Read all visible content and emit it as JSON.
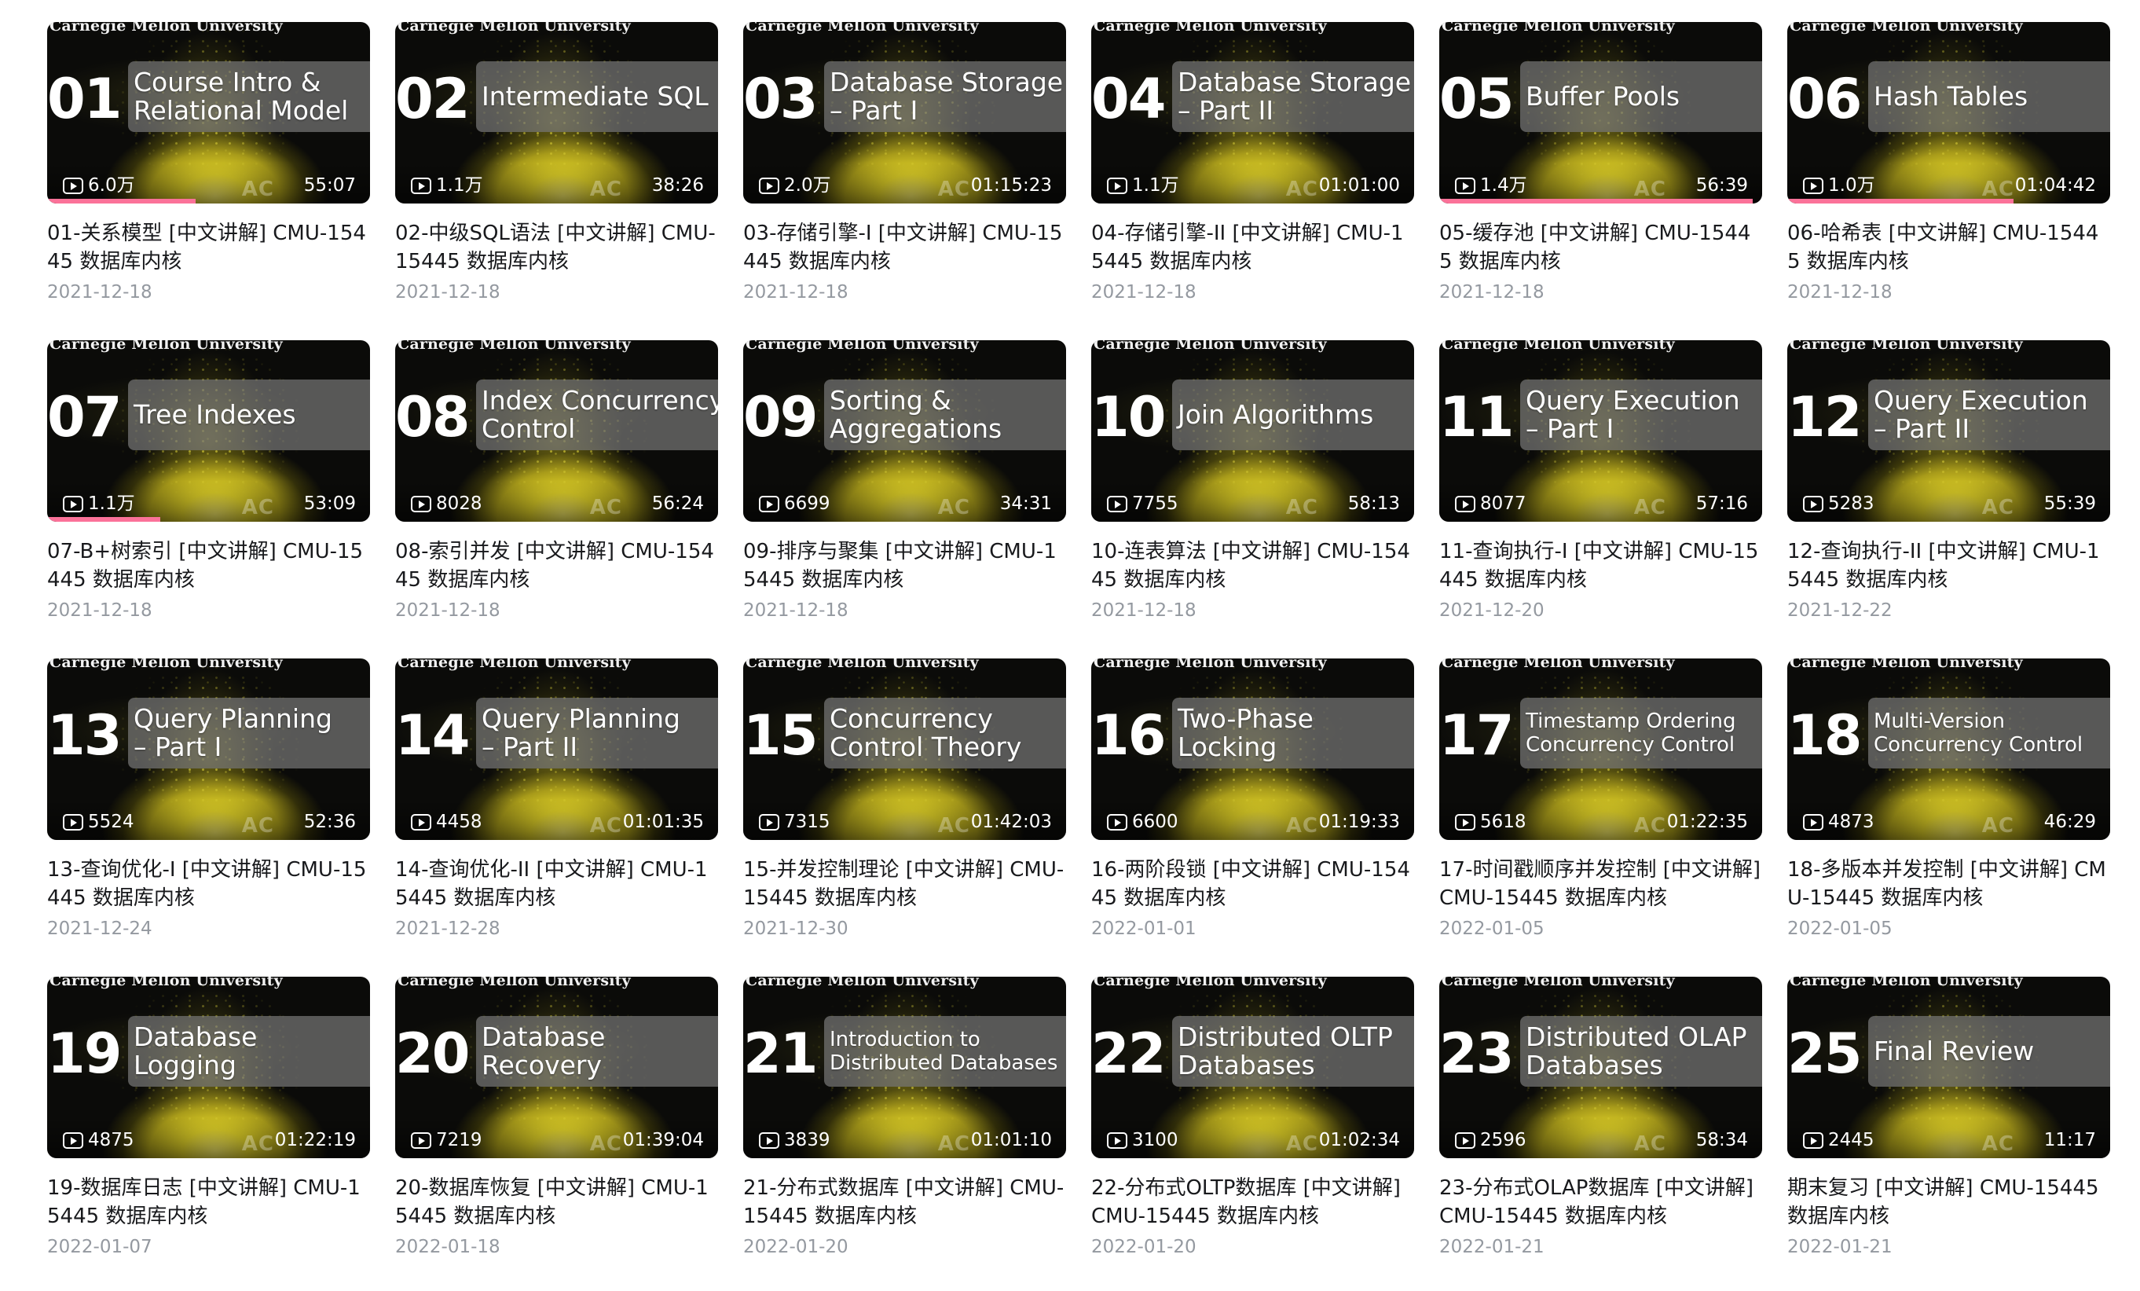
{
  "colors": {
    "title_text": "#18191c",
    "date_text": "#9499a0",
    "progress_bar": "#fb7299",
    "thumb_background": "#0b0b09",
    "thumb_glow": "#e4d528"
  },
  "thumbnail_common": {
    "header_text": "Carnegie Mellon University",
    "watermark": "AC",
    "icon": "play-count-icon"
  },
  "videos": [
    {
      "num": "01",
      "thumb_title": "Course Intro &\nRelational Model",
      "views": "6.0万",
      "duration": "55:07",
      "title": "01-关系模型 [中文讲解] CMU-15445 数据库内核",
      "date": "2021-12-18",
      "progress": 0.46
    },
    {
      "num": "02",
      "thumb_title": "Intermediate SQL",
      "views": "1.1万",
      "duration": "38:26",
      "title": "02-中级SQL语法 [中文讲解] CMU-15445 数据库内核",
      "date": "2021-12-18",
      "progress": 0
    },
    {
      "num": "03",
      "thumb_title": "Database Storage\n– Part I",
      "views": "2.0万",
      "duration": "01:15:23",
      "title": "03-存储引擎-I [中文讲解] CMU-15445 数据库内核",
      "date": "2021-12-18",
      "progress": 0
    },
    {
      "num": "04",
      "thumb_title": "Database Storage\n– Part II",
      "views": "1.1万",
      "duration": "01:01:00",
      "title": "04-存储引擎-II [中文讲解] CMU-15445 数据库内核",
      "date": "2021-12-18",
      "progress": 0
    },
    {
      "num": "05",
      "thumb_title": "Buffer Pools",
      "views": "1.4万",
      "duration": "56:39",
      "title": "05-缓存池 [中文讲解] CMU-15445 数据库内核",
      "date": "2021-12-18",
      "progress": 0.97
    },
    {
      "num": "06",
      "thumb_title": "Hash Tables",
      "views": "1.0万",
      "duration": "01:04:42",
      "title": "06-哈希表 [中文讲解] CMU-15445 数据库内核",
      "date": "2021-12-18",
      "progress": 0.7
    },
    {
      "num": "07",
      "thumb_title": "Tree Indexes",
      "views": "1.1万",
      "duration": "53:09",
      "title": "07-B+树索引 [中文讲解] CMU-15445 数据库内核",
      "date": "2021-12-18",
      "progress": 0.35
    },
    {
      "num": "08",
      "thumb_title": "Index Concurrency\nControl",
      "views": "8028",
      "duration": "56:24",
      "title": "08-索引并发 [中文讲解] CMU-15445 数据库内核",
      "date": "2021-12-18",
      "progress": 0
    },
    {
      "num": "09",
      "thumb_title": "Sorting &\nAggregations",
      "views": "6699",
      "duration": "34:31",
      "title": "09-排序与聚集 [中文讲解] CMU-15445 数据库内核",
      "date": "2021-12-18",
      "progress": 0
    },
    {
      "num": "10",
      "thumb_title": "Join Algorithms",
      "views": "7755",
      "duration": "58:13",
      "title": "10-连表算法 [中文讲解] CMU-15445 数据库内核",
      "date": "2021-12-18",
      "progress": 0
    },
    {
      "num": "11",
      "thumb_title": "Query Execution\n– Part I",
      "views": "8077",
      "duration": "57:16",
      "title": "11-查询执行-I [中文讲解] CMU-15445 数据库内核",
      "date": "2021-12-20",
      "progress": 0
    },
    {
      "num": "12",
      "thumb_title": "Query Execution\n– Part II",
      "views": "5283",
      "duration": "55:39",
      "title": "12-查询执行-II [中文讲解] CMU-15445 数据库内核",
      "date": "2021-12-22",
      "progress": 0
    },
    {
      "num": "13",
      "thumb_title": "Query Planning\n– Part I",
      "views": "5524",
      "duration": "52:36",
      "title": "13-查询优化-I [中文讲解] CMU-15445 数据库内核",
      "date": "2021-12-24",
      "progress": 0
    },
    {
      "num": "14",
      "thumb_title": "Query Planning\n– Part II",
      "views": "4458",
      "duration": "01:01:35",
      "title": "14-查询优化-II [中文讲解] CMU-15445 数据库内核",
      "date": "2021-12-28",
      "progress": 0
    },
    {
      "num": "15",
      "thumb_title": "Concurrency\nControl Theory",
      "views": "7315",
      "duration": "01:42:03",
      "title": "15-并发控制理论 [中文讲解] CMU-15445 数据库内核",
      "date": "2021-12-30",
      "progress": 0
    },
    {
      "num": "16",
      "thumb_title": "Two-Phase\nLocking",
      "views": "6600",
      "duration": "01:19:33",
      "title": "16-两阶段锁 [中文讲解] CMU-15445 数据库内核",
      "date": "2022-01-01",
      "progress": 0
    },
    {
      "num": "17",
      "thumb_title": "Timestamp Ordering\nConcurrency Control",
      "views": "5618",
      "duration": "01:22:35",
      "title": "17-时间戳顺序并发控制 [中文讲解] CMU-15445 数据库内核",
      "date": "2022-01-05",
      "progress": 0
    },
    {
      "num": "18",
      "thumb_title": "Multi-Version\nConcurrency Control",
      "views": "4873",
      "duration": "46:29",
      "title": "18-多版本并发控制 [中文讲解] CMU-15445 数据库内核",
      "date": "2022-01-05",
      "progress": 0
    },
    {
      "num": "19",
      "thumb_title": "Database\nLogging",
      "views": "4875",
      "duration": "01:22:19",
      "title": "19-数据库日志 [中文讲解] CMU-15445 数据库内核",
      "date": "2022-01-07",
      "progress": 0
    },
    {
      "num": "20",
      "thumb_title": "Database\nRecovery",
      "views": "7219",
      "duration": "01:39:04",
      "title": "20-数据库恢复 [中文讲解] CMU-15445 数据库内核",
      "date": "2022-01-18",
      "progress": 0
    },
    {
      "num": "21",
      "thumb_title": "Introduction to\nDistributed Databases",
      "views": "3839",
      "duration": "01:01:10",
      "title": "21-分布式数据库 [中文讲解] CMU-15445 数据库内核",
      "date": "2022-01-20",
      "progress": 0
    },
    {
      "num": "22",
      "thumb_title": "Distributed OLTP\nDatabases",
      "views": "3100",
      "duration": "01:02:34",
      "title": "22-分布式OLTP数据库 [中文讲解] CMU-15445 数据库内核",
      "date": "2022-01-20",
      "progress": 0
    },
    {
      "num": "23",
      "thumb_title": "Distributed OLAP\nDatabases",
      "views": "2596",
      "duration": "58:34",
      "title": "23-分布式OLAP数据库 [中文讲解] CMU-15445 数据库内核",
      "date": "2022-01-21",
      "progress": 0
    },
    {
      "num": "25",
      "thumb_title": "Final Review",
      "views": "2445",
      "duration": "11:17",
      "title": "期末复习 [中文讲解] CMU-15445 数据库内核",
      "date": "2022-01-21",
      "progress": 0
    }
  ]
}
